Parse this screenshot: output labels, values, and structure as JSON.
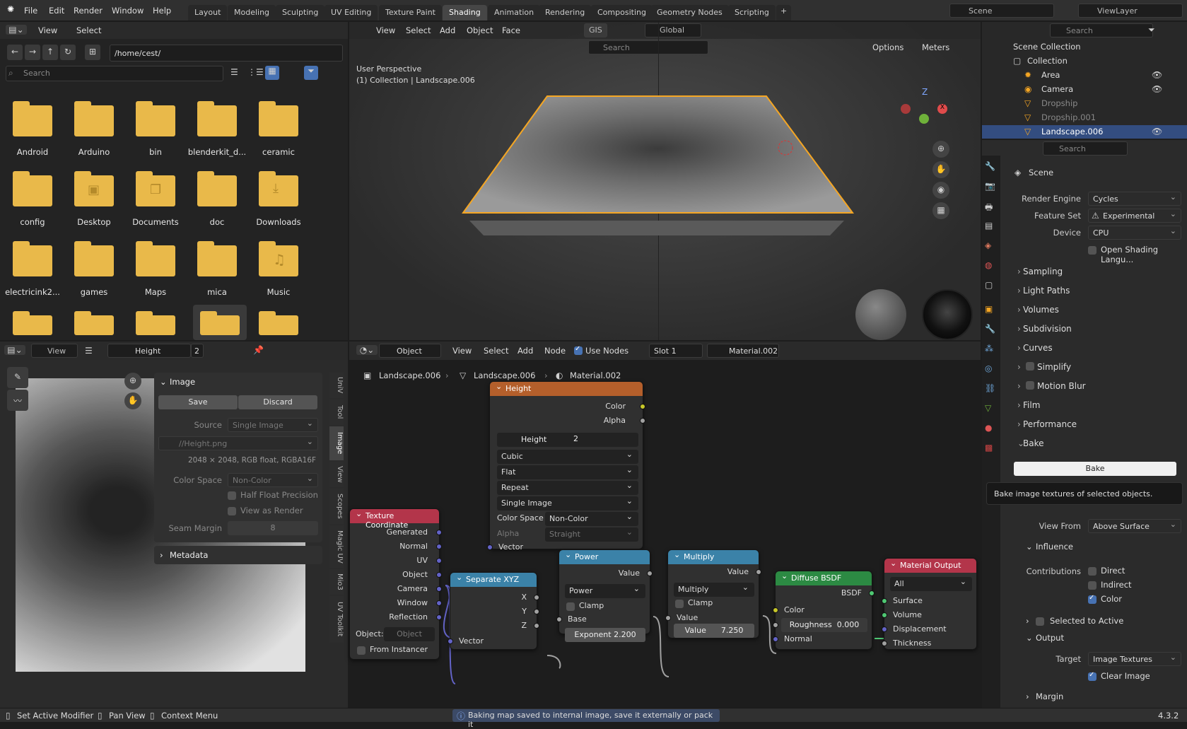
{
  "topbar": {
    "menus": [
      "File",
      "Edit",
      "Render",
      "Window",
      "Help"
    ],
    "workspaces": [
      "Layout",
      "Modeling",
      "Sculpting",
      "UV Editing",
      "Texture Paint",
      "Shading",
      "Animation",
      "Rendering",
      "Compositing",
      "Geometry Nodes",
      "Scripting"
    ],
    "active_workspace": "Shading",
    "scene": "Scene",
    "view_layer": "ViewLayer"
  },
  "file_browser": {
    "menu": [
      "View",
      "Select"
    ],
    "path": "/home/cest/",
    "search_placeholder": "Search",
    "folders": [
      "Android",
      "Arduino",
      "bin",
      "blenderkit_d...",
      "ceramic",
      "config",
      "Desktop",
      "Documents",
      "doc",
      "Downloads",
      "electricink2...",
      "games",
      "Maps",
      "mica",
      "Music"
    ]
  },
  "viewport": {
    "menu": [
      "View",
      "Select",
      "Add",
      "Object",
      "Face"
    ],
    "orientation": "Global",
    "gis": "GIS",
    "options": "Options",
    "units": "Meters",
    "search_placeholder": "Search",
    "perspective": "User Perspective",
    "collection_info": "(1) Collection | Landscape.006"
  },
  "outliner": {
    "search_placeholder": "Search",
    "root": "Scene Collection",
    "collection": "Collection",
    "items": [
      "Area",
      "Camera",
      "Dropship",
      "Dropship.001",
      "Landscape.006"
    ]
  },
  "properties": {
    "search_placeholder": "Search",
    "scene": "Scene",
    "render_engine_label": "Render Engine",
    "render_engine": "Cycles",
    "feature_set_label": "Feature Set",
    "feature_set": "Experimental",
    "device_label": "Device",
    "device": "CPU",
    "osl_label": "Open Shading Langu...",
    "sections": [
      "Sampling",
      "Light Paths",
      "Volumes",
      "Subdivision",
      "Curves",
      "Simplify",
      "Motion Blur",
      "Film",
      "Performance",
      "Bake"
    ],
    "bake_button": "Bake",
    "tooltip": "Bake image textures of selected objects.",
    "view_from_label": "View From",
    "view_from": "Above Surface",
    "influence": "Influence",
    "contributions": "Contributions",
    "direct": "Direct",
    "indirect": "Indirect",
    "color": "Color",
    "selected_to_active": "Selected to Active",
    "output": "Output",
    "target_label": "Target",
    "target": "Image Textures",
    "clear_image": "Clear Image",
    "margin": "Margin"
  },
  "image_editor": {
    "view": "View",
    "image_name": "Height",
    "users": "2",
    "panel_title": "Image",
    "save": "Save",
    "discard": "Discard",
    "source_label": "Source",
    "source": "Single Image",
    "filepath": "//Height.png",
    "info": "2048 × 2048,  RGB float, RGBA16F",
    "color_space_label": "Color Space",
    "color_space": "Non-Color",
    "half_float": "Half Float Precision",
    "view_as_render": "View as Render",
    "seam_margin_label": "Seam Margin",
    "seam_margin": "8",
    "metadata": "Metadata",
    "tabs": [
      "UniV",
      "Tool",
      "Image",
      "View",
      "Scopes",
      "Magic UV",
      "Mio3",
      "UV Toolkit"
    ]
  },
  "node_editor": {
    "object": "Object",
    "menu": [
      "View",
      "Select",
      "Add",
      "Node"
    ],
    "use_nodes": "Use Nodes",
    "slot": "Slot 1",
    "material": "Material.002",
    "breadcrumb": [
      "Landscape.006",
      "Landscape.006",
      "Material.002"
    ],
    "nodes": {
      "height": {
        "title": "Height",
        "out_color": "Color",
        "out_alpha": "Alpha",
        "image": "Height",
        "users": "2",
        "interp": "Cubic",
        "proj": "Flat",
        "ext": "Repeat",
        "source": "Single Image",
        "cs_label": "Color Space",
        "cs": "Non-Color",
        "alpha_label": "Alpha",
        "alpha": "Straight",
        "vector": "Vector"
      },
      "texcoord": {
        "title": "Texture Coordinate",
        "outputs": [
          "Generated",
          "Normal",
          "UV",
          "Object",
          "Camera",
          "Window",
          "Reflection"
        ],
        "object_label": "Object:",
        "object_placeholder": "Object",
        "from_instancer": "From Instancer"
      },
      "sepxyz": {
        "title": "Separate XYZ",
        "x": "X",
        "y": "Y",
        "z": "Z",
        "vector": "Vector"
      },
      "power": {
        "title": "Power",
        "value": "Value",
        "op": "Power",
        "clamp": "Clamp",
        "base": "Base",
        "exponent": "Exponent",
        "exponent_value": "2.200"
      },
      "multiply": {
        "title": "Multiply",
        "value": "Value",
        "op": "Multiply",
        "clamp": "Clamp",
        "in_value": "Value",
        "value_label": "Value",
        "value_num": "7.250"
      },
      "diffuse": {
        "title": "Diffuse BSDF",
        "bsdf": "BSDF",
        "color": "Color",
        "roughness": "Roughness",
        "roughness_value": "0.000",
        "normal": "Normal"
      },
      "output": {
        "title": "Material Output",
        "target": "All",
        "surface": "Surface",
        "volume": "Volume",
        "displacement": "Displacement",
        "thickness": "Thickness"
      }
    }
  },
  "statusbar": {
    "left": [
      "Set Active Modifier",
      "Pan View",
      "Context Menu"
    ],
    "message": "Baking map saved to internal image, save it externally or pack it",
    "version": "4.3.2"
  },
  "colors": {
    "accent": "#4772b3",
    "folder": "#e9b94a",
    "selection": "#f5a623"
  }
}
